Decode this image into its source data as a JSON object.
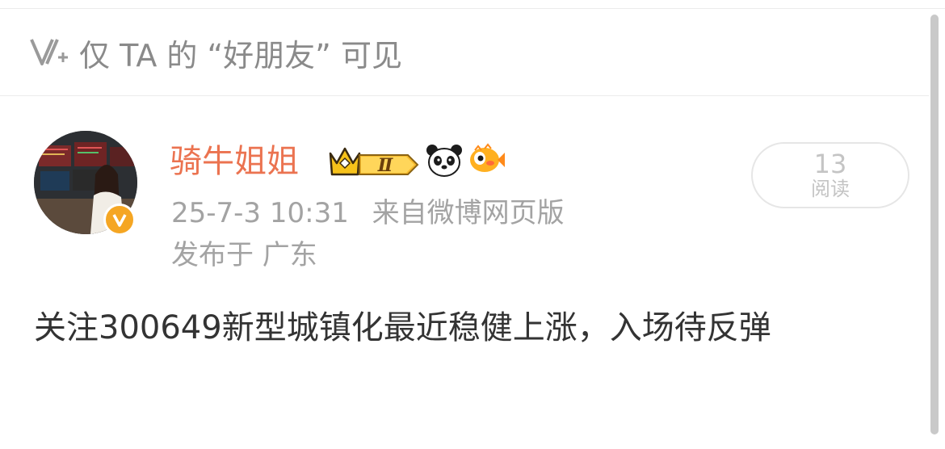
{
  "visibility": {
    "icon": "friends-visibility-icon",
    "text": "仅 TA 的 “好朋友” 可见"
  },
  "author": {
    "name": "骑牛姐姐",
    "name_color": "#eb7350",
    "verified": true,
    "verified_color": "#f5a623",
    "level_badge": "Ⅱ",
    "emoji_badges": [
      "panda-icon",
      "fish-icon"
    ]
  },
  "meta": {
    "time": "25-7-3 10:31",
    "source": "来自微博网页版",
    "location": "发布于 广东"
  },
  "read": {
    "count": "13",
    "label": "阅读"
  },
  "post": {
    "text": "关注300649新型城镇化最近稳健上涨，入场待反弹"
  }
}
